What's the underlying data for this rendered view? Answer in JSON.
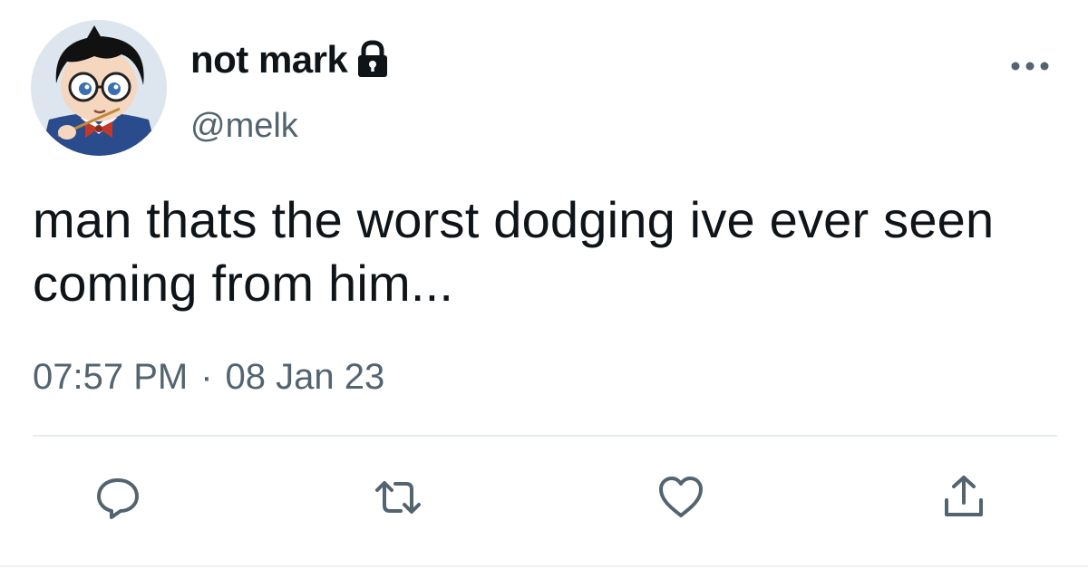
{
  "user": {
    "display_name": "not mark",
    "handle": "@melk",
    "protected_icon": "lock-icon",
    "avatar": "cartoon-avatar"
  },
  "tweet": {
    "text": "man thats the worst dodging ive ever seen coming from him...",
    "time": "07:57 PM",
    "separator": "·",
    "date": "08 Jan 23"
  },
  "actions": [
    {
      "icon": "reply-icon"
    },
    {
      "icon": "retweet-icon"
    },
    {
      "icon": "like-icon"
    },
    {
      "icon": "share-icon"
    }
  ],
  "menu_icon": "more-icon",
  "colors": {
    "text_primary": "#0f1419",
    "text_secondary": "#536471",
    "icon_gray": "#536471",
    "divider": "#e6ecf0"
  }
}
